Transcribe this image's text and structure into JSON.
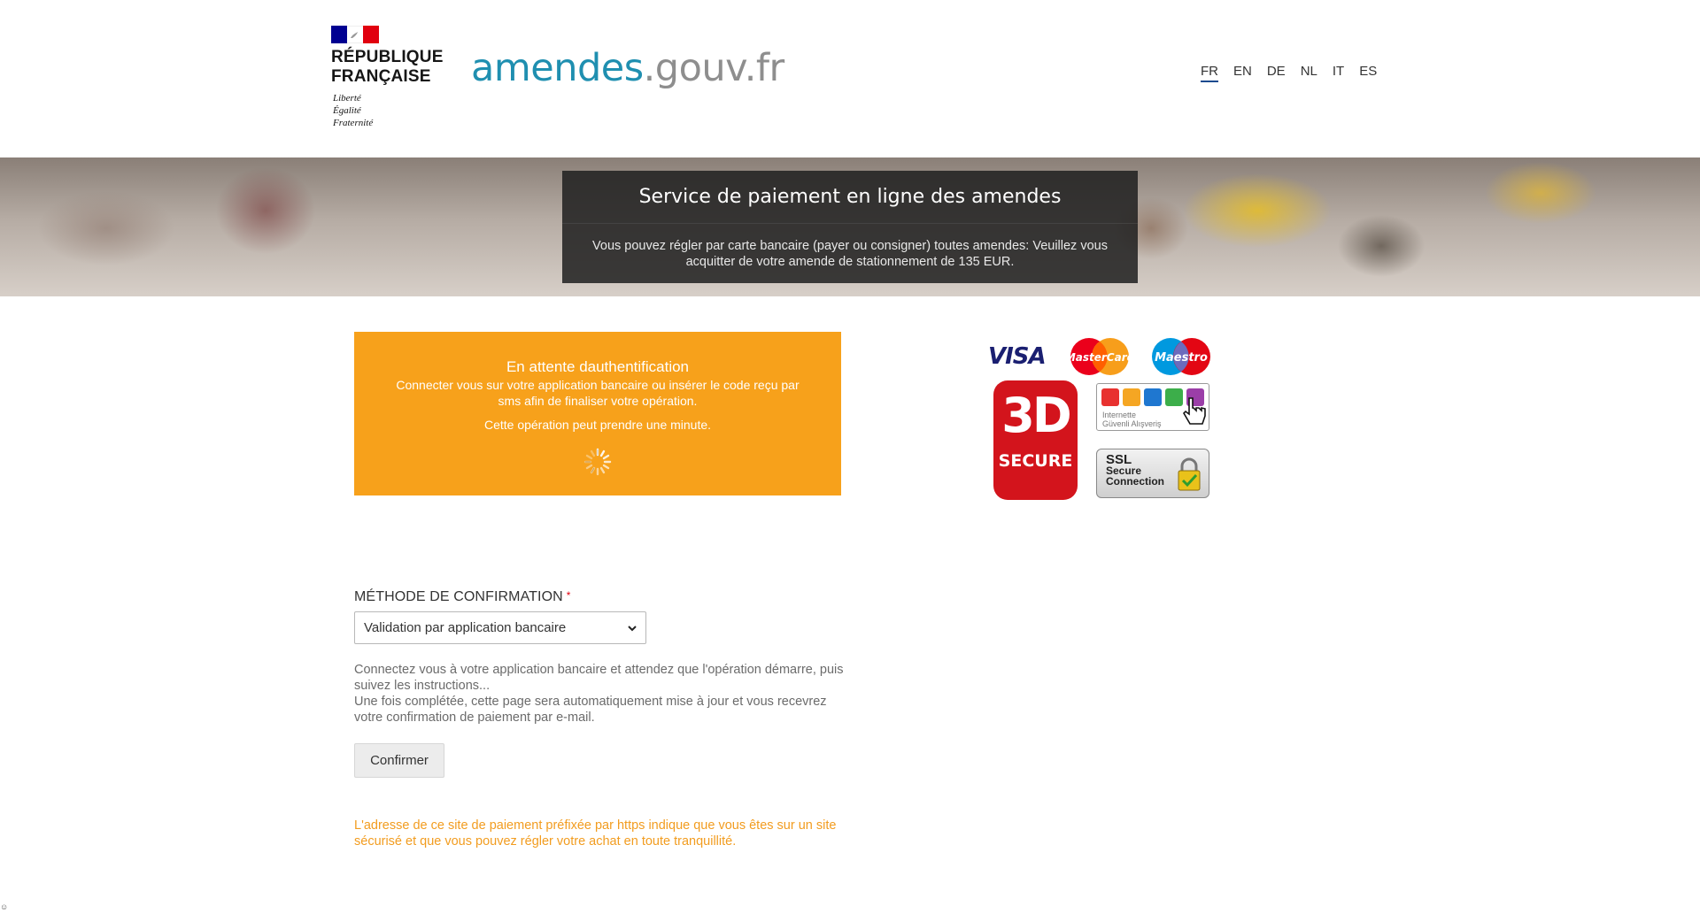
{
  "header": {
    "republic_name_line1": "RÉPUBLIQUE",
    "republic_name_line2": "FRANÇAISE",
    "motto_line1": "Liberté",
    "motto_line2": "Égalité",
    "motto_line3": "Fraternité",
    "brand_part1": "amendes",
    "brand_part2": ".gouv.fr",
    "languages": [
      "FR",
      "EN",
      "DE",
      "NL",
      "IT",
      "ES"
    ],
    "active_language": "FR"
  },
  "banner": {
    "title": "Service de paiement en ligne des amendes",
    "text": "Vous pouvez régler par carte bancaire (payer ou consigner) toutes amendes: Veuillez vous acquitter de votre amende de stationnement de 135 EUR."
  },
  "pending": {
    "title": "En attente dauthentification",
    "text": "Connecter vous sur votre application bancaire ou insérer le code reçu par sms afin de finaliser votre opération.",
    "note": "Cette opération peut prendre une minute."
  },
  "payment_logos": {
    "visa": "VISA",
    "mastercard": "MasterCard",
    "maestro": "Maestro",
    "secure3d_big": "3D",
    "secure3d_small": "SECURE",
    "igai_caption_line1": "Internette",
    "igai_caption_line2": "Güvenli Alışveriş",
    "ssl_line1": "SSL",
    "ssl_line2": "Secure",
    "ssl_line3": "Connection"
  },
  "form": {
    "method_label": "MÉTHODE DE CONFIRMATION",
    "required_mark": "*",
    "selected_method": "Validation par application bancaire",
    "help_line1": "Connectez vous à votre application bancaire et attendez que l'opération démarre, puis suivez les instructions...",
    "help_line2": "Une fois complétée, cette page sera automatiquement mise à jour et vous recevrez votre confirmation de paiement par e-mail.",
    "confirm_button": "Confirmer",
    "secure_note": "L'adresse de ce site de paiement préfixée par https indique que vous êtes sur un site sécurisé et que vous pouvez régler votre achat en toute tranquillité."
  },
  "colors": {
    "brand_blue": "#1f8fb0",
    "brand_gray": "#8e8e8e",
    "pending_orange": "#f7a11b",
    "note_orange": "#f29c1f",
    "secure3d_red": "#d3141c"
  },
  "corner_glyph": "☺"
}
